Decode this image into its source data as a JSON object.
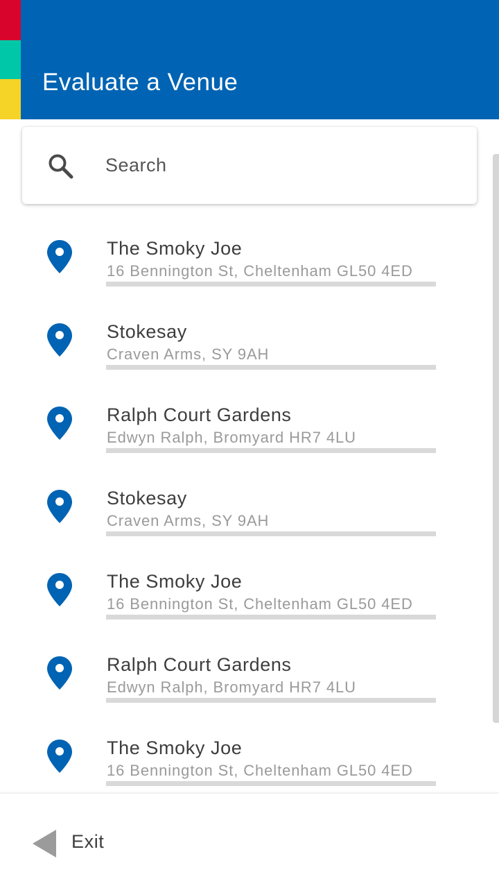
{
  "header": {
    "title": "Evaluate a Venue",
    "stripe_colors": [
      "#d9042b",
      "#00c7a8",
      "#f5d327"
    ],
    "background": "#0063b3"
  },
  "search": {
    "placeholder": "Search",
    "value": "",
    "icon": "search-icon"
  },
  "venues": [
    {
      "name": "The Smoky Joe",
      "address": "16 Bennington St, Cheltenham GL50 4ED",
      "icon": "location-pin-icon"
    },
    {
      "name": "Stokesay",
      "address": "Craven Arms, SY 9AH",
      "icon": "location-pin-icon"
    },
    {
      "name": "Ralph Court Gardens",
      "address": "Edwyn Ralph, Bromyard HR7 4LU",
      "icon": "location-pin-icon"
    },
    {
      "name": "Stokesay",
      "address": "Craven Arms, SY 9AH",
      "icon": "location-pin-icon"
    },
    {
      "name": "The Smoky Joe",
      "address": "16 Bennington St, Cheltenham GL50 4ED",
      "icon": "location-pin-icon"
    },
    {
      "name": "Ralph Court Gardens",
      "address": "Edwyn Ralph, Bromyard HR7 4LU",
      "icon": "location-pin-icon"
    },
    {
      "name": "The Smoky Joe",
      "address": "16 Bennington St, Cheltenham GL50 4ED",
      "icon": "location-pin-icon"
    }
  ],
  "footer": {
    "exit_label": "Exit",
    "exit_icon": "back-triangle-icon"
  },
  "colors": {
    "accent": "#0063b3",
    "pin": "#0063b3",
    "text": "#3d3d3d",
    "subtext": "#9a9a9a",
    "divider": "#d9d9d9"
  }
}
